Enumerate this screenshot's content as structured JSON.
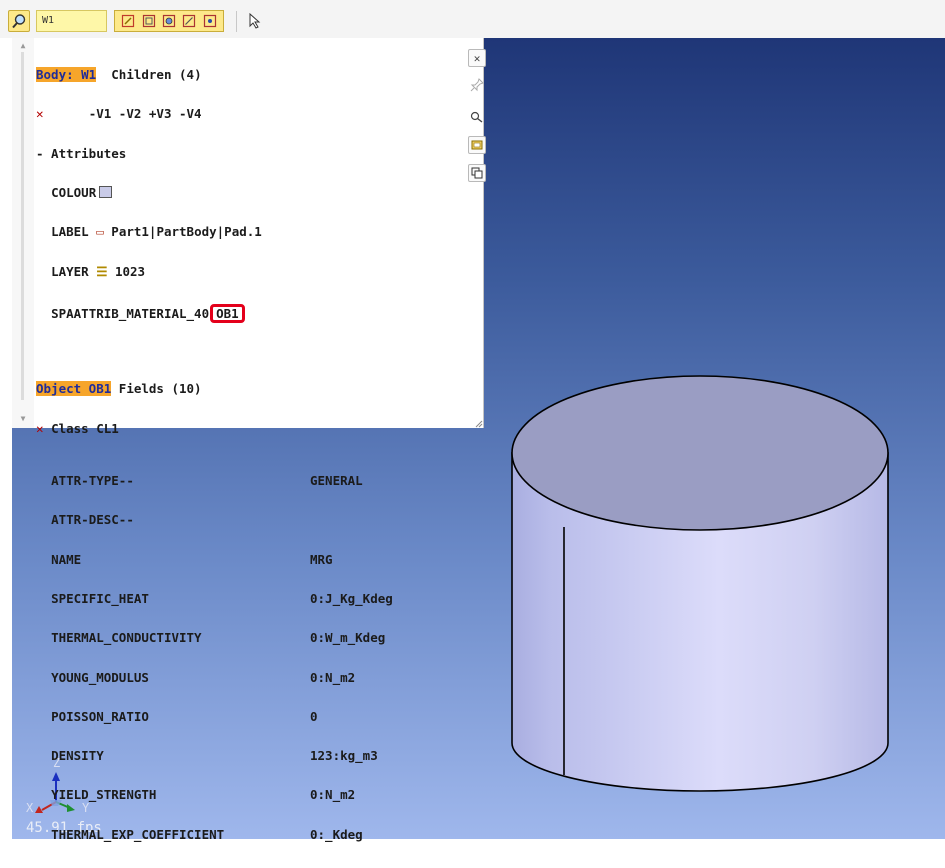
{
  "toolbar": {
    "name_field_value": "W1",
    "icons": [
      "zoom-lens-icon",
      "select-face-icon",
      "select-edge-icon",
      "select-body-icon",
      "select-vertex-icon",
      "select-point-icon",
      "pointer-arrow-icon"
    ]
  },
  "inspector": {
    "body_label": "Body: W1",
    "children_label": "Children (4)",
    "children_list": "-V1 -V2 +V3 -V4",
    "attributes_label": "- Attributes",
    "colour_label": "COLOUR",
    "label_label": "LABEL",
    "label_value": "Part1|PartBody|Pad.1",
    "layer_label": "LAYER",
    "layer_value": "1023",
    "material_label": "SPAATTRIB_MATERIAL_40",
    "material_value": "OB1",
    "object_label": "Object OB1",
    "fields_label": "Fields (10)",
    "class_label": "Class CL1",
    "fields": [
      {
        "name": "ATTR-TYPE--",
        "value": "GENERAL"
      },
      {
        "name": "ATTR-DESC--",
        "value": ""
      },
      {
        "name": "NAME",
        "value": "MRG"
      },
      {
        "name": "SPECIFIC_HEAT",
        "value": "0:J_Kg_Kdeg"
      },
      {
        "name": "THERMAL_CONDUCTIVITY",
        "value": "0:W_m_Kdeg"
      },
      {
        "name": "YOUNG_MODULUS",
        "value": "0:N_m2"
      },
      {
        "name": "POISSON_RATIO",
        "value": "0"
      },
      {
        "name": "DENSITY",
        "value": "123:kg_m3"
      },
      {
        "name": "YIELD_STRENGTH",
        "value": "0:N_m2"
      },
      {
        "name": "THERMAL_EXP_COEFFICIENT",
        "value": "0:_Kdeg"
      }
    ]
  },
  "viewport": {
    "axis_z": "Z",
    "axis_x": "X",
    "axis_y": "Y",
    "fps": "45.91 fps"
  },
  "colors": {
    "highlight": "#f6a52a",
    "highlight_text": "#202d9a",
    "callout_border": "#e4001b",
    "viewport_top": "#1f3677",
    "viewport_bottom": "#9fb7ec"
  }
}
